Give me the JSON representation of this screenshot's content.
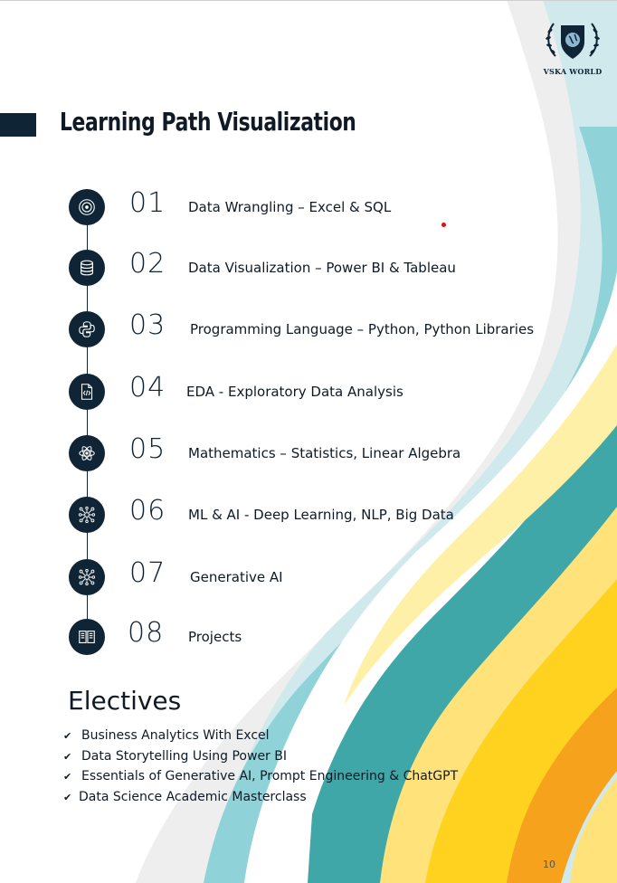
{
  "logo": {
    "text": "VSKA WORLD"
  },
  "page_title": "Learning Path Visualization",
  "steps": [
    {
      "number": "01",
      "label": "Data Wrangling – Excel & SQL",
      "icon": "target-icon"
    },
    {
      "number": "02",
      "label": "Data Visualization – Power BI & Tableau",
      "icon": "database-icon"
    },
    {
      "number": "03",
      "label": "Programming Language – Python, Python Libraries",
      "icon": "python-icon"
    },
    {
      "number": "04",
      "label": "EDA - Exploratory Data Analysis",
      "icon": "code-file-icon"
    },
    {
      "number": "05",
      "label": "Mathematics – Statistics, Linear Algebra",
      "icon": "atom-icon"
    },
    {
      "number": "06",
      "label": "ML & AI - Deep Learning, NLP, Big Data",
      "icon": "neural-network-icon"
    },
    {
      "number": "07",
      "label": "Generative AI",
      "icon": "neural-network-icon"
    },
    {
      "number": "08",
      "label": "Projects",
      "icon": "book-icon"
    }
  ],
  "electives": {
    "title": "Electives",
    "items": [
      "Business Analytics With Excel",
      "Data Storytelling Using Power BI",
      "Essentials of Generative AI, Prompt Engineering & ChatGPT",
      "Data Science Academic Masterclass"
    ],
    "bullet_icon": "checkmark-icon"
  },
  "page_number": "10",
  "colors": {
    "navy": "#0f2435",
    "teal": "#3fa7a8",
    "light_teal": "#b9e3e6",
    "yellow": "#ffd21f",
    "orange": "#f6a21c"
  }
}
